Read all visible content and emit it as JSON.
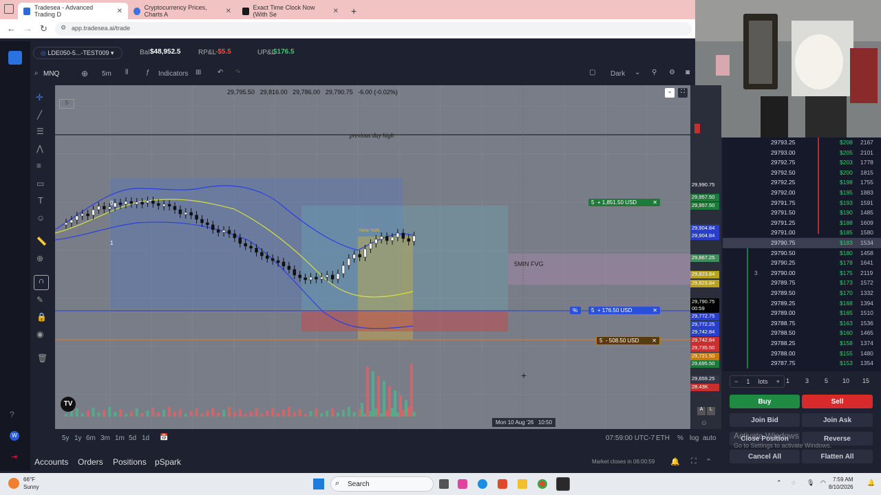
{
  "browser": {
    "tabs": [
      {
        "title": "Tradesea - Advanced Trading D",
        "active": true,
        "favicon_color": "#2f6bd8"
      },
      {
        "title": "Cryptocurrency Prices, Charts A",
        "active": false,
        "favicon_color": "#3d72e0"
      },
      {
        "title": "Exact Time Clock Now (With Se",
        "active": false,
        "favicon_color": "#1a1a1a"
      }
    ],
    "new_tab_label": "+",
    "url": "app.tradesea.ai/trade"
  },
  "topbar": {
    "account": "LDE050-5...-TEST009",
    "bal_label": "Bal",
    "bal_value": "$48,952.5",
    "rpnl_label": "RP&L",
    "rpnl_value": "-$5.5",
    "upnl_label": "UP&L",
    "upnl_value": "$176.5"
  },
  "toolbar": {
    "symbol": "MNQ",
    "interval": "5m",
    "indicators_label": "Indicators",
    "theme_label": "Dark"
  },
  "chart": {
    "legend_num": "5",
    "ohlc": [
      "29,795.50",
      "29,816.00",
      "29,786.00",
      "29,790.75",
      "-6.00",
      "(-0.02%)"
    ],
    "prev_day_high_label": "previous day high",
    "session_label": "New York",
    "fvg_label": "5MIN FVG",
    "zero_label": "0",
    "one_label": "1",
    "crosshair_time": "Mon 10 Aug '26",
    "crosshair_clock": "10:50",
    "positions": [
      {
        "qty": "5",
        "text": "+ 1,851.50 USD",
        "color": "#1e7a3a"
      },
      {
        "qty": "5",
        "text": "+ 176.50 USD",
        "color": "#2a4fd8"
      },
      {
        "qty": "5",
        "text": "- 508.50 USD",
        "color": "#c77a10"
      }
    ],
    "bottom_btns": [
      "A",
      "L"
    ]
  },
  "price_axis": {
    "labels": [
      {
        "text": "29,990.75",
        "bg": "#2a2d3a"
      },
      {
        "text": "29,957.50",
        "bg": "#1e7a3a"
      },
      {
        "text": "29,957.50",
        "bg": "#1e7a3a"
      },
      {
        "text": "29,904.84",
        "bg": "#2a3fc8"
      },
      {
        "text": "29,904.84",
        "bg": "#2a3fc8"
      },
      {
        "text": "29,867.25",
        "bg": "#3e8d5a"
      },
      {
        "text": "29,823.84",
        "bg": "#b8a020"
      },
      {
        "text": "29,823.84",
        "bg": "#b8a020"
      },
      {
        "text": "29,790.75",
        "bg": "#000000"
      },
      {
        "text": "00:59",
        "bg": "#000000"
      },
      {
        "text": "29,772.75",
        "bg": "#2a3fc8"
      },
      {
        "text": "29,772.25",
        "bg": "#2a3fc8"
      },
      {
        "text": "29,742.84",
        "bg": "#2a3fc8"
      },
      {
        "text": "29,742.84",
        "bg": "#c83030"
      },
      {
        "text": "29,735.50",
        "bg": "#c83030"
      },
      {
        "text": "29,721.50",
        "bg": "#c77a10"
      },
      {
        "text": "29,695.50",
        "bg": "#1e7a3a"
      },
      {
        "text": "29,659.25",
        "bg": "#333848"
      },
      {
        "text": "28.43K",
        "bg": "#c83030"
      }
    ]
  },
  "timeframes": [
    "5y",
    "1y",
    "6m",
    "3m",
    "1m",
    "5d",
    "1d"
  ],
  "bottom_right": {
    "clock": "07:59:00 UTC-7",
    "eth": "ETH",
    "pct": "%",
    "log": "log",
    "auto": "auto"
  },
  "bottom_nav": {
    "tabs": [
      "Accounts",
      "Orders",
      "Positions",
      "pSpark"
    ],
    "market_closes": "Market closes in 06:00:59"
  },
  "ladder": {
    "rows": [
      {
        "price": "29793.25",
        "bid": "$208",
        "vol": "2167"
      },
      {
        "price": "29793.00",
        "bid": "$205",
        "vol": "2101"
      },
      {
        "price": "29792.75",
        "bid": "$203",
        "vol": "1778"
      },
      {
        "price": "29792.50",
        "bid": "$200",
        "vol": "1815"
      },
      {
        "price": "29792.25",
        "bid": "$198",
        "vol": "1755"
      },
      {
        "price": "29792.00",
        "bid": "$195",
        "vol": "1883"
      },
      {
        "price": "29791.75",
        "bid": "$193",
        "vol": "1591"
      },
      {
        "price": "29791.50",
        "bid": "$190",
        "vol": "1485"
      },
      {
        "price": "29791.25",
        "bid": "$188",
        "vol": "1609"
      },
      {
        "price": "29791.00",
        "bid": "$185",
        "vol": "1580"
      },
      {
        "price": "29790.75",
        "bid": "$183",
        "vol": "1534"
      },
      {
        "price": "29790.50",
        "bid": "$180",
        "vol": "1458"
      },
      {
        "price": "29790.25",
        "bid": "$178",
        "vol": "1641"
      },
      {
        "price": "29790.00",
        "bid": "$175",
        "vol": "2119"
      },
      {
        "price": "29789.75",
        "bid": "$173",
        "vol": "1572"
      },
      {
        "price": "29789.50",
        "bid": "$170",
        "vol": "1332"
      },
      {
        "price": "29789.25",
        "bid": "$168",
        "vol": "1394"
      },
      {
        "price": "29789.00",
        "bid": "$165",
        "vol": "1510"
      },
      {
        "price": "29788.75",
        "bid": "$163",
        "vol": "1536"
      },
      {
        "price": "29788.50",
        "bid": "$160",
        "vol": "1465"
      },
      {
        "price": "29788.25",
        "bid": "$158",
        "vol": "1374"
      },
      {
        "price": "29788.00",
        "bid": "$155",
        "vol": "1480"
      },
      {
        "price": "29787.75",
        "bid": "$153",
        "vol": "1354"
      }
    ],
    "position_qty": "3"
  },
  "order_panel": {
    "qty": "1",
    "lots_label": "lots",
    "minus": "−",
    "plus": "+",
    "presets": [
      "1",
      "3",
      "5",
      "10",
      "15"
    ],
    "buy": "Buy",
    "sell": "Sell",
    "join_bid": "Join Bid",
    "join_ask": "Join Ask",
    "close_position": "Close Position",
    "reverse": "Reverse",
    "cancel_all": "Cancel All",
    "flatten_all": "Flatten All",
    "watermark_1": "Activate Windows",
    "watermark_2": "Go to Settings to activate Windows."
  },
  "taskbar": {
    "weather_temp": "66°F",
    "weather_desc": "Sunny",
    "search": "Search",
    "time": "7:59 AM",
    "date": "8/10/2026"
  }
}
